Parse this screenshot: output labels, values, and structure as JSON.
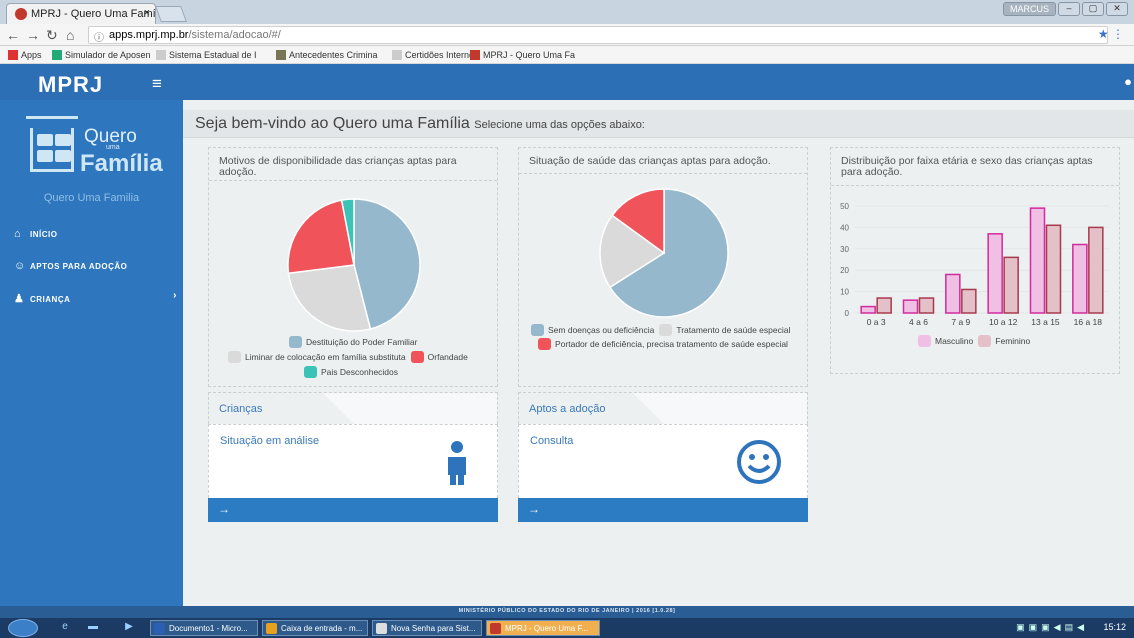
{
  "browser": {
    "tab_title": "MPRJ - Quero Uma Famí",
    "tab_close": "×",
    "user_badge": "MARCUS",
    "url_host": "apps.mprj.mp.br",
    "url_path": "/sistema/adocao/#/",
    "bookmarks": [
      {
        "label": "Apps",
        "color": "#d33"
      },
      {
        "label": "Simulador de Aposen",
        "color": "#2a7"
      },
      {
        "label": "Sistema Estadual de I",
        "color": "#ccc"
      },
      {
        "label": "Antecedentes Crimina",
        "color": "#775"
      },
      {
        "label": "Certidões Internet",
        "color": "#ccc"
      },
      {
        "label": "MPRJ - Quero Uma Fa",
        "color": "#c0392b"
      }
    ]
  },
  "app": {
    "logo": "MPRJ",
    "brand_quero": "Quero",
    "brand_uma": "uma",
    "brand_familia": "Família",
    "brand_subtitle": "Quero Uma Familia",
    "menu": [
      {
        "label": "INÍCIO",
        "icon": "home-icon"
      },
      {
        "label": "APTOS PARA ADOÇÃO",
        "icon": "smile-icon"
      },
      {
        "label": "CRIANÇA",
        "icon": "child-icon"
      }
    ],
    "welcome_title": "Seja bem-vindo ao Quero uma Família",
    "welcome_sub": "Selecione uma das opções abaixo:",
    "footer": "MINISTÉRIO PÚBLICO DO ESTADO DO RIO DE JANEIRO | 2016 [1.0.28]"
  },
  "panels": {
    "p1_title": "Motivos de disponibilidade das crianças aptas para adoção.",
    "p2_title": "Situação de saúde das crianças aptas para adoção.",
    "p3_title": "Distribuição por faixa etária e sexo das crianças aptas para adoção."
  },
  "cards": {
    "c1_head": "Crianças",
    "c1_link": "Situação em análise",
    "c2_head": "Aptos a adoção",
    "c2_link": "Consulta",
    "arrow": "→"
  },
  "chart_data": [
    {
      "type": "pie",
      "labels": [
        "Destituição do Poder Familiar",
        "Liminar de colocação em família substituta",
        "Orfandade",
        "Pais Desconhecidos"
      ],
      "values": [
        46,
        27,
        24,
        3
      ],
      "colors": [
        "#95b8cd",
        "#dadada",
        "#f05359",
        "#3cc3b8"
      ]
    },
    {
      "type": "pie",
      "labels": [
        "Sem doenças ou deficiência",
        "Tratamento de saúde especial",
        "Portador de deficiência, precisa tratamento de saúde especial"
      ],
      "values": [
        66,
        19,
        15
      ],
      "colors": [
        "#95b8cd",
        "#dadada",
        "#f05359"
      ]
    },
    {
      "type": "bar",
      "categories": [
        "0 a 3",
        "4 a 6",
        "7 a 9",
        "10 a 12",
        "13 a 15",
        "16 a 18"
      ],
      "series": [
        {
          "name": "Masculino",
          "values": [
            3,
            6,
            18,
            37,
            49,
            32
          ],
          "fill": "#f0c0e4",
          "stroke": "#d22b9c"
        },
        {
          "name": "Feminino",
          "values": [
            7,
            7,
            11,
            26,
            41,
            40
          ],
          "fill": "#e4c0c8",
          "stroke": "#a83a4e"
        }
      ],
      "ylim": [
        0,
        50
      ],
      "yticks": [
        0,
        10,
        20,
        30,
        40,
        50
      ],
      "grid": true
    }
  ],
  "taskbar": {
    "items": [
      {
        "label": "Documento1 - Micro...",
        "color": "#2b5fb4"
      },
      {
        "label": "Caixa de entrada - m...",
        "color": "#e8a020"
      },
      {
        "label": "Nova Senha para Sist...",
        "color": "#ddd"
      },
      {
        "label": "MPRJ - Quero Uma F...",
        "color": "#c0392b"
      }
    ],
    "clock": "15:12"
  }
}
